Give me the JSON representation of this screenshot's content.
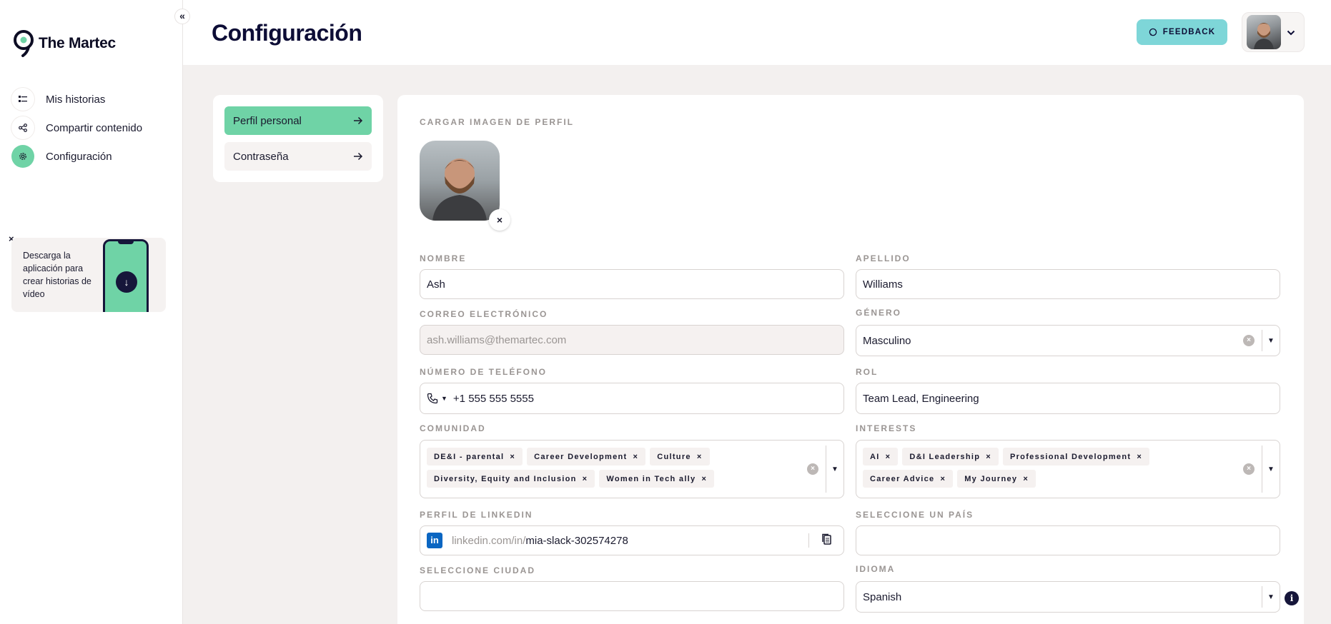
{
  "sidebar": {
    "collapse_icon": "«",
    "brand": "The Martec",
    "items": [
      {
        "label": "Mis historias",
        "icon": "list-icon"
      },
      {
        "label": "Compartir contenido",
        "icon": "share-icon"
      },
      {
        "label": "Configuración",
        "icon": "gear-icon",
        "active": true
      }
    ],
    "promo": {
      "close": "×",
      "text": "Descarga la aplicación para crear historias de vídeo",
      "download_icon": "↓"
    }
  },
  "header": {
    "title": "Configuración",
    "feedback_label": "FEEDBACK",
    "user_menu_caret": "⌄"
  },
  "settings_nav": [
    {
      "label": "Perfil personal",
      "active": true
    },
    {
      "label": "Contraseña",
      "active": false
    }
  ],
  "profile": {
    "upload_label": "CARGAR IMAGEN DE PERFIL",
    "remove_label": "×",
    "fields": {
      "first_name": {
        "label": "NOMBRE",
        "value": "Ash"
      },
      "last_name": {
        "label": "APELLIDO",
        "value": "Williams"
      },
      "email": {
        "label": "CORREO ELECTRÓNICO",
        "value": "ash.williams@themartec.com"
      },
      "gender": {
        "label": "GÉNERO",
        "value": "Masculino"
      },
      "phone": {
        "label": "NÚMERO DE TELÉFONO",
        "value": "+1 555 555 5555"
      },
      "role": {
        "label": "ROL",
        "value": "Team Lead, Engineering"
      },
      "community": {
        "label": "COMUNIDAD",
        "tags": [
          "DE&I - parental",
          "Career Development",
          "Culture",
          "Diversity, Equity and Inclusion",
          "Women in Tech ally"
        ]
      },
      "interests": {
        "label": "INTERESTS",
        "tags": [
          "AI",
          "D&I Leadership",
          "Professional Development",
          "Career Advice",
          "My Journey"
        ]
      },
      "linkedin": {
        "label": "PERFIL DE LINKEDIN",
        "prefix": "linkedin.com/in/",
        "value": "mia-slack-302574278"
      },
      "country": {
        "label": "SELECCIONE UN PAÍS",
        "value": ""
      },
      "city": {
        "label": "SELECCIONE CIUDAD",
        "value": ""
      },
      "language": {
        "label": "IDIOMA",
        "value": "Spanish"
      }
    }
  },
  "colors": {
    "accent": "#6fd3a6",
    "feedback": "#7ed6d8",
    "navy": "#0d0d36"
  }
}
